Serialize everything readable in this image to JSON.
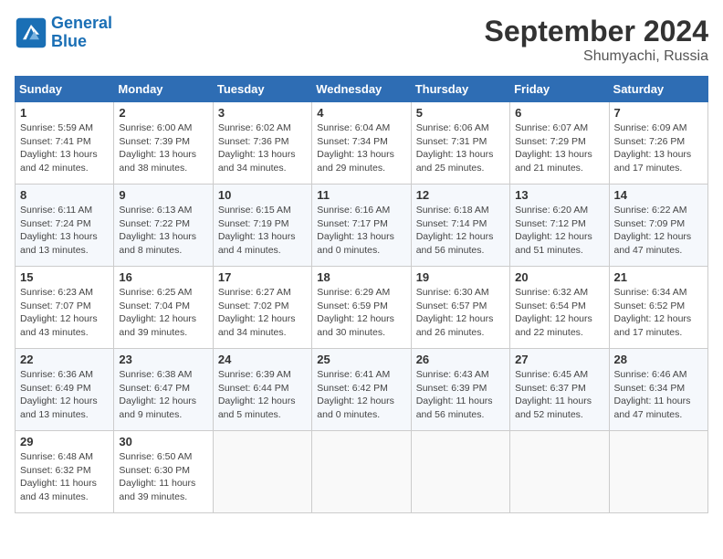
{
  "header": {
    "logo_line1": "General",
    "logo_line2": "Blue",
    "month": "September 2024",
    "location": "Shumyachi, Russia"
  },
  "weekdays": [
    "Sunday",
    "Monday",
    "Tuesday",
    "Wednesday",
    "Thursday",
    "Friday",
    "Saturday"
  ],
  "weeks": [
    [
      {
        "day": "1",
        "info": "Sunrise: 5:59 AM\nSunset: 7:41 PM\nDaylight: 13 hours\nand 42 minutes."
      },
      {
        "day": "2",
        "info": "Sunrise: 6:00 AM\nSunset: 7:39 PM\nDaylight: 13 hours\nand 38 minutes."
      },
      {
        "day": "3",
        "info": "Sunrise: 6:02 AM\nSunset: 7:36 PM\nDaylight: 13 hours\nand 34 minutes."
      },
      {
        "day": "4",
        "info": "Sunrise: 6:04 AM\nSunset: 7:34 PM\nDaylight: 13 hours\nand 29 minutes."
      },
      {
        "day": "5",
        "info": "Sunrise: 6:06 AM\nSunset: 7:31 PM\nDaylight: 13 hours\nand 25 minutes."
      },
      {
        "day": "6",
        "info": "Sunrise: 6:07 AM\nSunset: 7:29 PM\nDaylight: 13 hours\nand 21 minutes."
      },
      {
        "day": "7",
        "info": "Sunrise: 6:09 AM\nSunset: 7:26 PM\nDaylight: 13 hours\nand 17 minutes."
      }
    ],
    [
      {
        "day": "8",
        "info": "Sunrise: 6:11 AM\nSunset: 7:24 PM\nDaylight: 13 hours\nand 13 minutes."
      },
      {
        "day": "9",
        "info": "Sunrise: 6:13 AM\nSunset: 7:22 PM\nDaylight: 13 hours\nand 8 minutes."
      },
      {
        "day": "10",
        "info": "Sunrise: 6:15 AM\nSunset: 7:19 PM\nDaylight: 13 hours\nand 4 minutes."
      },
      {
        "day": "11",
        "info": "Sunrise: 6:16 AM\nSunset: 7:17 PM\nDaylight: 13 hours\nand 0 minutes."
      },
      {
        "day": "12",
        "info": "Sunrise: 6:18 AM\nSunset: 7:14 PM\nDaylight: 12 hours\nand 56 minutes."
      },
      {
        "day": "13",
        "info": "Sunrise: 6:20 AM\nSunset: 7:12 PM\nDaylight: 12 hours\nand 51 minutes."
      },
      {
        "day": "14",
        "info": "Sunrise: 6:22 AM\nSunset: 7:09 PM\nDaylight: 12 hours\nand 47 minutes."
      }
    ],
    [
      {
        "day": "15",
        "info": "Sunrise: 6:23 AM\nSunset: 7:07 PM\nDaylight: 12 hours\nand 43 minutes."
      },
      {
        "day": "16",
        "info": "Sunrise: 6:25 AM\nSunset: 7:04 PM\nDaylight: 12 hours\nand 39 minutes."
      },
      {
        "day": "17",
        "info": "Sunrise: 6:27 AM\nSunset: 7:02 PM\nDaylight: 12 hours\nand 34 minutes."
      },
      {
        "day": "18",
        "info": "Sunrise: 6:29 AM\nSunset: 6:59 PM\nDaylight: 12 hours\nand 30 minutes."
      },
      {
        "day": "19",
        "info": "Sunrise: 6:30 AM\nSunset: 6:57 PM\nDaylight: 12 hours\nand 26 minutes."
      },
      {
        "day": "20",
        "info": "Sunrise: 6:32 AM\nSunset: 6:54 PM\nDaylight: 12 hours\nand 22 minutes."
      },
      {
        "day": "21",
        "info": "Sunrise: 6:34 AM\nSunset: 6:52 PM\nDaylight: 12 hours\nand 17 minutes."
      }
    ],
    [
      {
        "day": "22",
        "info": "Sunrise: 6:36 AM\nSunset: 6:49 PM\nDaylight: 12 hours\nand 13 minutes."
      },
      {
        "day": "23",
        "info": "Sunrise: 6:38 AM\nSunset: 6:47 PM\nDaylight: 12 hours\nand 9 minutes."
      },
      {
        "day": "24",
        "info": "Sunrise: 6:39 AM\nSunset: 6:44 PM\nDaylight: 12 hours\nand 5 minutes."
      },
      {
        "day": "25",
        "info": "Sunrise: 6:41 AM\nSunset: 6:42 PM\nDaylight: 12 hours\nand 0 minutes."
      },
      {
        "day": "26",
        "info": "Sunrise: 6:43 AM\nSunset: 6:39 PM\nDaylight: 11 hours\nand 56 minutes."
      },
      {
        "day": "27",
        "info": "Sunrise: 6:45 AM\nSunset: 6:37 PM\nDaylight: 11 hours\nand 52 minutes."
      },
      {
        "day": "28",
        "info": "Sunrise: 6:46 AM\nSunset: 6:34 PM\nDaylight: 11 hours\nand 47 minutes."
      }
    ],
    [
      {
        "day": "29",
        "info": "Sunrise: 6:48 AM\nSunset: 6:32 PM\nDaylight: 11 hours\nand 43 minutes."
      },
      {
        "day": "30",
        "info": "Sunrise: 6:50 AM\nSunset: 6:30 PM\nDaylight: 11 hours\nand 39 minutes."
      },
      {
        "day": "",
        "info": ""
      },
      {
        "day": "",
        "info": ""
      },
      {
        "day": "",
        "info": ""
      },
      {
        "day": "",
        "info": ""
      },
      {
        "day": "",
        "info": ""
      }
    ]
  ]
}
